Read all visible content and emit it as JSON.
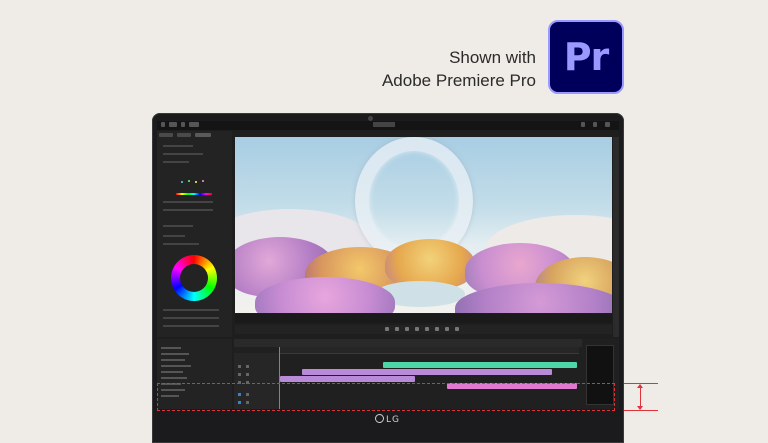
{
  "caption": {
    "line1": "Shown with",
    "line2": "Adobe Premiere Pro"
  },
  "app_logo": {
    "text": "Pr",
    "background": "#00005B",
    "foreground": "#9999FF"
  },
  "laptop": {
    "brand": "LG"
  },
  "timeline": {
    "clip_colors": [
      "#4fd6a8",
      "#b98ad8",
      "#e07ad0"
    ]
  },
  "highlight": {
    "color": "#E0323A",
    "style": "dashed"
  }
}
